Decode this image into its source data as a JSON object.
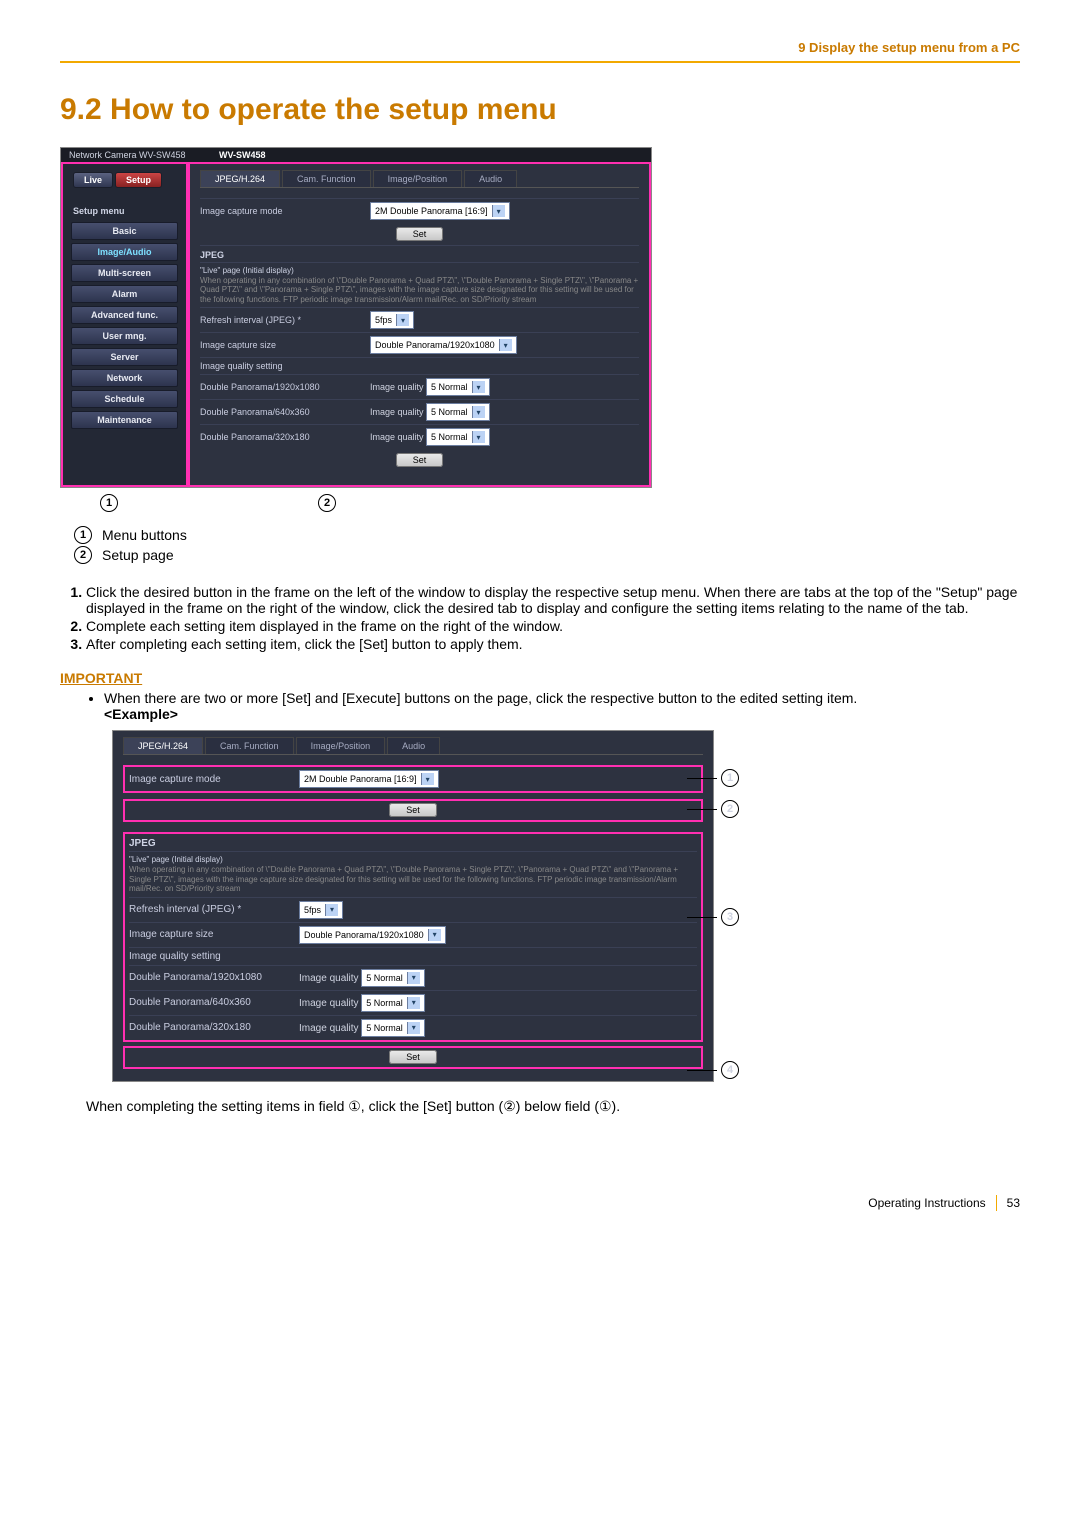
{
  "header": {
    "breadcrumb": "9 Display the setup menu from a PC"
  },
  "title": "9.2  How to operate the setup menu",
  "shot": {
    "top_left": "Network Camera\nWV-SW458",
    "model": "WV-SW458",
    "toggle": {
      "live": "Live",
      "setup": "Setup"
    },
    "side_title": "Setup menu",
    "menu": [
      "Basic",
      "Image/Audio",
      "Multi-screen",
      "Alarm",
      "Advanced func.",
      "User mng.",
      "Server",
      "Network",
      "Schedule",
      "Maintenance"
    ],
    "highlighted_menu_index": 1,
    "tabs": [
      "JPEG/H.264",
      "Cam. Function",
      "Image/Position",
      "Audio"
    ],
    "active_tab_index": 0,
    "capture_mode_label": "Image capture mode",
    "capture_mode_value": "2M Double Panorama [16:9]",
    "set_label": "Set",
    "jpeg_title": "JPEG",
    "note_title": "\"Live\" page (Initial display)",
    "note_body": "When operating in any combination of \\\"Double Panorama + Quad PTZ\\\", \\\"Double Panorama + Single PTZ\\\", \\\"Panorama + Quad PTZ\\\" and \\\"Panorama + Single PTZ\\\", images with the image capture size designated for this setting will be used for the following functions. FTP periodic image transmission/Alarm mail/Rec. on SD/Priority stream",
    "rows": {
      "refresh_label": "Refresh interval (JPEG) *",
      "refresh_value": "5fps",
      "size_label": "Image capture size",
      "size_value": "Double Panorama/1920x1080",
      "qset_label": "Image quality setting",
      "q_rows": [
        "Double Panorama/1920x1080",
        "Double Panorama/640x360",
        "Double Panorama/320x180"
      ],
      "q_prefix": "Image quality",
      "q_value": "5 Normal"
    }
  },
  "legend": {
    "1": "Menu buttons",
    "2": "Setup page"
  },
  "steps": [
    "Click the desired button in the frame on the left of the window to display the respective setup menu. When there are tabs at the top of the \"Setup\" page displayed in the frame on the right of the window, click the desired tab to display and configure the setting items relating to the name of the tab.",
    "Complete each setting item displayed in the frame on the right of the window.",
    "After completing each setting item, click the [Set] button to apply them."
  ],
  "important_label": "IMPORTANT",
  "important_text": "When there are two or more [Set] and [Execute] buttons on the page, click the respective button to the edited setting item.",
  "example_label": "<Example>",
  "closing": "When completing the setting items in field ①, click the [Set] button (②) below field (①).",
  "footer": {
    "label": "Operating Instructions",
    "page": "53"
  }
}
